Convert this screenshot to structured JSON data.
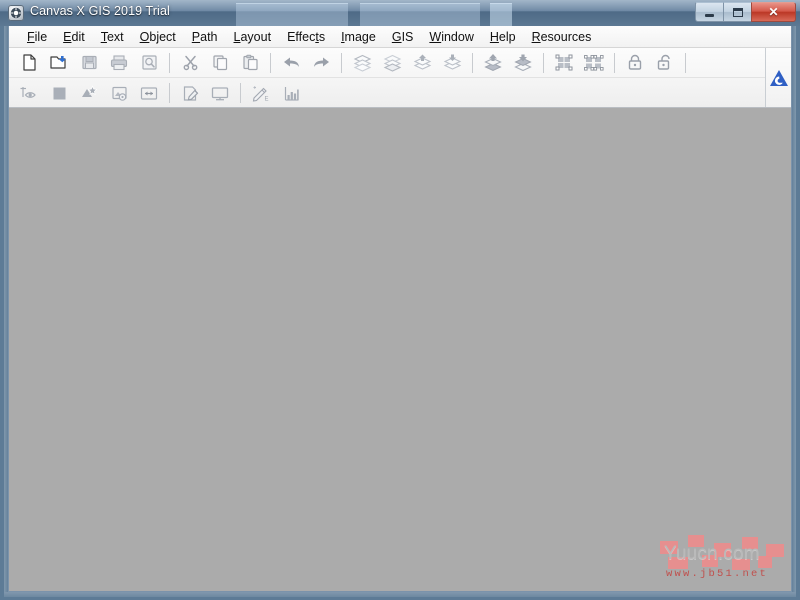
{
  "window": {
    "title": "Canvas X GIS 2019 Trial",
    "app_icon": "canvas-app-icon",
    "caption": {
      "minimize_label": "Minimize",
      "maximize_label": "Maximize",
      "close_label": "Close",
      "close_glyph": "✕"
    },
    "colors": {
      "titlebar": "#5c7893",
      "frame": "#5d7b96",
      "canvas": "#ababab",
      "accent_blue": "#2f5fc4",
      "close_red": "#bb3726"
    }
  },
  "menubar": {
    "items": [
      {
        "label": "File",
        "mnemonic": "F"
      },
      {
        "label": "Edit",
        "mnemonic": "E"
      },
      {
        "label": "Text",
        "mnemonic": "T"
      },
      {
        "label": "Object",
        "mnemonic": "O"
      },
      {
        "label": "Path",
        "mnemonic": "P"
      },
      {
        "label": "Layout",
        "mnemonic": "L"
      },
      {
        "label": "Effects",
        "mnemonic": "t"
      },
      {
        "label": "Image",
        "mnemonic": "I"
      },
      {
        "label": "GIS",
        "mnemonic": "G"
      },
      {
        "label": "Window",
        "mnemonic": "W"
      },
      {
        "label": "Help",
        "mnemonic": "H"
      },
      {
        "label": "Resources",
        "mnemonic": "R"
      }
    ]
  },
  "toolbar_row1": {
    "items": [
      {
        "icon": "new-document-icon",
        "label": "New",
        "enabled": true
      },
      {
        "icon": "open-folder-icon",
        "label": "Open",
        "enabled": true
      },
      {
        "icon": "save-icon",
        "label": "Save",
        "enabled": false
      },
      {
        "icon": "print-icon",
        "label": "Print",
        "enabled": false
      },
      {
        "icon": "print-preview-icon",
        "label": "Print Preview",
        "enabled": false
      },
      {
        "icon": "separator",
        "label": "",
        "enabled": false
      },
      {
        "icon": "cut-scissors-icon",
        "label": "Cut",
        "enabled": false
      },
      {
        "icon": "copy-icon",
        "label": "Copy",
        "enabled": false
      },
      {
        "icon": "paste-icon",
        "label": "Paste",
        "enabled": false
      },
      {
        "icon": "separator",
        "label": "",
        "enabled": false
      },
      {
        "icon": "undo-arrow-icon",
        "label": "Undo",
        "enabled": false
      },
      {
        "icon": "redo-arrow-icon",
        "label": "Redo",
        "enabled": false
      },
      {
        "icon": "separator",
        "label": "",
        "enabled": false
      },
      {
        "icon": "bring-to-front-icon",
        "label": "Bring To Front",
        "enabled": false
      },
      {
        "icon": "send-to-back-icon",
        "label": "Send To Back",
        "enabled": false
      },
      {
        "icon": "bring-forward-icon",
        "label": "Bring Forward",
        "enabled": false
      },
      {
        "icon": "send-backward-icon",
        "label": "Send Backward",
        "enabled": false
      },
      {
        "icon": "separator",
        "label": "",
        "enabled": false
      },
      {
        "icon": "move-layer-up-icon",
        "label": "Move Layer Up",
        "enabled": false
      },
      {
        "icon": "move-layer-down-icon",
        "label": "Move Layer Down",
        "enabled": false
      },
      {
        "icon": "separator",
        "label": "",
        "enabled": false
      },
      {
        "icon": "group-icon",
        "label": "Group",
        "enabled": false
      },
      {
        "icon": "ungroup-icon",
        "label": "Ungroup",
        "enabled": false
      },
      {
        "icon": "separator",
        "label": "",
        "enabled": false
      },
      {
        "icon": "lock-icon",
        "label": "Lock",
        "enabled": false
      },
      {
        "icon": "unlock-icon",
        "label": "Unlock",
        "enabled": false
      },
      {
        "icon": "separator",
        "label": "",
        "enabled": false
      }
    ]
  },
  "toolbar_row2": {
    "items": [
      {
        "icon": "visibility-eye-icon",
        "label": "Show/Hide",
        "enabled": false
      },
      {
        "icon": "fill-color-icon",
        "label": "Fill Color",
        "enabled": false
      },
      {
        "icon": "effects-sparkle-icon",
        "label": "Effects",
        "enabled": false
      },
      {
        "icon": "image-settings-icon",
        "label": "Image Settings",
        "enabled": false
      },
      {
        "icon": "resize-width-icon",
        "label": "Resize",
        "enabled": false
      },
      {
        "icon": "separator",
        "label": "",
        "enabled": false
      },
      {
        "icon": "edit-document-icon",
        "label": "Edit Document",
        "enabled": false
      },
      {
        "icon": "display-monitor-icon",
        "label": "Display",
        "enabled": false
      },
      {
        "icon": "separator",
        "label": "",
        "enabled": false
      },
      {
        "icon": "annotate-pen-icon",
        "label": "Annotate",
        "enabled": false
      },
      {
        "icon": "bar-chart-icon",
        "label": "Chart",
        "enabled": false
      }
    ]
  },
  "brand": {
    "logo_icon": "canvas-gis-logo-icon",
    "logo_color": "#2f5fc4"
  },
  "canvas": {
    "background_color": "#ababab",
    "document_open": false
  },
  "watermark": {
    "primary_text": "Yuucn.com",
    "secondary_text": "www.jb51.net"
  }
}
